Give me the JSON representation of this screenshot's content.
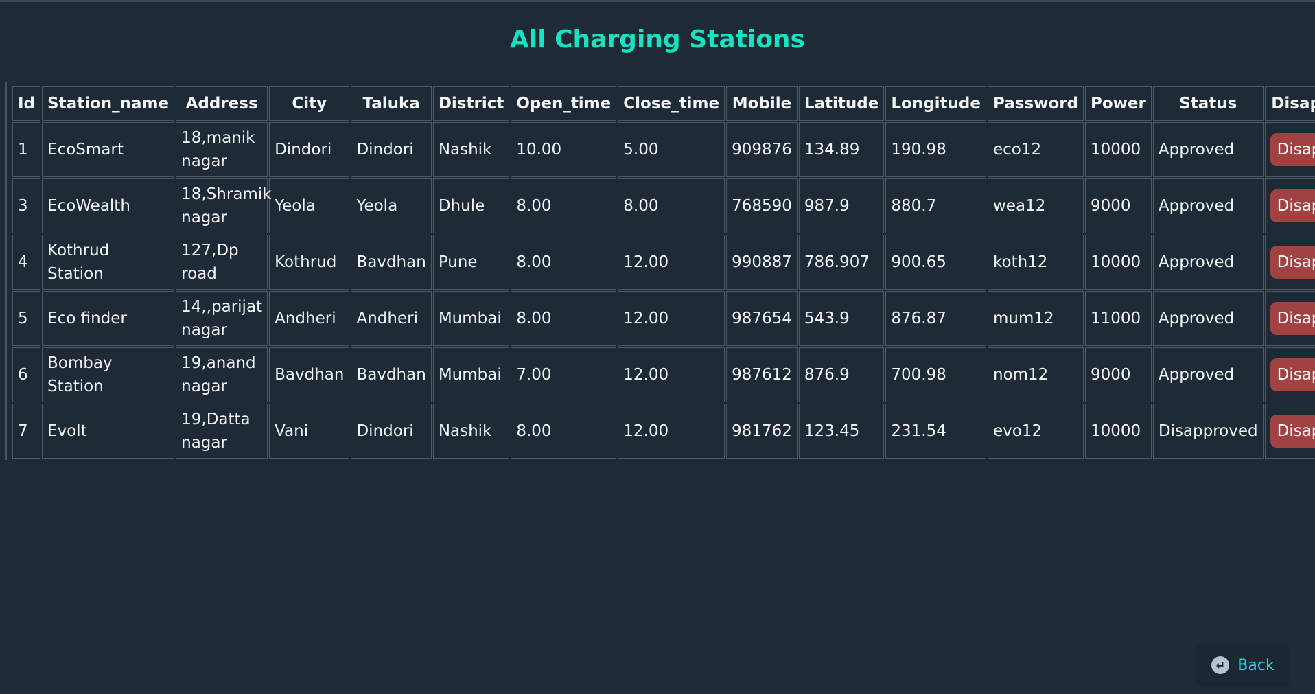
{
  "page": {
    "title": "All Charging Stations"
  },
  "table": {
    "headers": [
      "Id",
      "Station_name",
      "Address",
      "City",
      "Taluka",
      "District",
      "Open_time",
      "Close_time",
      "Mobile",
      "Latitude",
      "Longitude",
      "Password",
      "Power",
      "Status",
      "Disapprove"
    ],
    "rows": [
      [
        "1",
        "EcoSmart",
        "18,manik nagar",
        "Dindori",
        "Dindori",
        "Nashik",
        "10.00",
        "5.00",
        "909876",
        "134.89",
        "190.98",
        "eco12",
        "10000",
        "Approved"
      ],
      [
        "3",
        "EcoWealth",
        "18,Shramik nagar",
        "Yeola",
        "Yeola",
        "Dhule",
        "8.00",
        "8.00",
        "768590",
        "987.9",
        "880.7",
        "wea12",
        "9000",
        "Approved"
      ],
      [
        "4",
        "Kothrud Station",
        "127,Dp road",
        "Kothrud",
        "Bavdhan",
        "Pune",
        "8.00",
        "12.00",
        "990887",
        "786.907",
        "900.65",
        "koth12",
        "10000",
        "Approved"
      ],
      [
        "5",
        "Eco finder",
        "14,,parijat nagar",
        "Andheri",
        "Andheri",
        "Mumbai",
        "8.00",
        "12.00",
        "987654",
        "543.9",
        "876.87",
        "mum12",
        "11000",
        "Approved"
      ],
      [
        "6",
        "Bombay Station",
        "19,anand nagar",
        "Bavdhan",
        "Bavdhan",
        "Mumbai",
        "7.00",
        "12.00",
        "987612",
        "876.9",
        "700.98",
        "nom12",
        "9000",
        "Approved"
      ],
      [
        "7",
        "Evolt",
        "19,Datta nagar",
        "Vani",
        "Dindori",
        "Nashik",
        "8.00",
        "12.00",
        "981762",
        "123.45",
        "231.54",
        "evo12",
        "10000",
        "Disapproved"
      ]
    ],
    "action_label": "Disapprove"
  },
  "back": {
    "label": "Back",
    "icon": "back-arrow-icon"
  },
  "colors": {
    "background": "#1e2a36",
    "title": "#17e3c1",
    "button": "#a04242",
    "back_text": "#18d9f0"
  }
}
